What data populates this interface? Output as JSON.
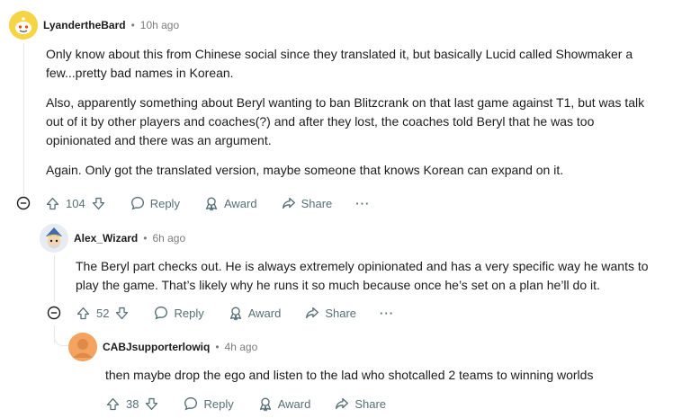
{
  "comments": [
    {
      "username": "LyandertheBard",
      "time": "10h ago",
      "paragraphs": [
        "Only know about this from Chinese social since they translated it, but basically Lucid called Showmaker a few...pretty bad names in Korean.",
        "Also, apparently something about Beryl wanting to ban Blitzcrank on that last game against T1, but was talk out of it by other players and coaches(?) and after they lost, the coaches told Beryl that he was too opinionated and there was an argument.",
        "Again. Only got the translated version, maybe someone that knows Korean can expand on it."
      ],
      "votes": "104"
    },
    {
      "username": "Alex_Wizard",
      "time": "6h ago",
      "paragraphs": [
        "The Beryl part checks out. He is always extremely opinionated and has a very specific way he wants to play the game. That’s likely why he runs it so much because once he’s set on a plan he’ll do it."
      ],
      "votes": "52"
    },
    {
      "username": "CABJsupporterlowiq",
      "time": "4h ago",
      "paragraphs": [
        "then maybe drop the ego and listen to the lad who shotcalled 2 teams to winning worlds"
      ],
      "votes": "38"
    }
  ],
  "labels": {
    "separator": "•",
    "reply": "Reply",
    "award": "Award",
    "share": "Share",
    "more": "···"
  },
  "colors": {
    "text": "#1c1c1c",
    "meta": "#7c7c7c",
    "action": "#576f76",
    "line": "#e5e7e9",
    "avatar1": "#f5d547",
    "avatar3": "#f4a460"
  },
  "icons": [
    "upvote-icon",
    "downvote-icon",
    "reply-bubble-icon",
    "award-icon",
    "share-arrow-icon",
    "collapse-minus-icon",
    "more-dots-icon"
  ]
}
